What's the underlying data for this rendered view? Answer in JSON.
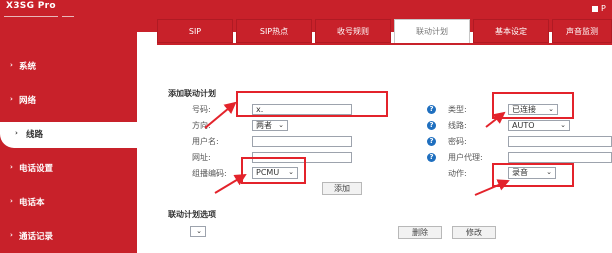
{
  "brand": {
    "model": "X3SG Pro"
  },
  "header_right": {
    "text": "P"
  },
  "sidebar": {
    "items": [
      {
        "label": "系统"
      },
      {
        "label": "网络"
      },
      {
        "label": "线路"
      },
      {
        "label": "电话设置"
      },
      {
        "label": "电话本"
      },
      {
        "label": "通话记录"
      }
    ],
    "active_index": 2
  },
  "tabs": [
    {
      "label": "SIP"
    },
    {
      "label": "SIP热点"
    },
    {
      "label": "收号规则"
    },
    {
      "label": "联动计划"
    },
    {
      "label": "基本设定"
    },
    {
      "label": "声音监测"
    }
  ],
  "active_tab": "联动计划",
  "form": {
    "title": "添加联动计划",
    "number_label": "号码:",
    "number_value": "x.",
    "direction_label": "方向:",
    "direction_value": "两者",
    "username_label": "用户名:",
    "url_label": "网址:",
    "codec_label": "组播编码:",
    "codec_value": "PCMU",
    "type_label": "类型:",
    "type_value": "已连接",
    "line_label": "线路:",
    "line_value": "AUTO",
    "password_label": "密码:",
    "proxy_label": "用户代理:",
    "action_label": "动作:",
    "action_value": "录音",
    "add_button": "添加"
  },
  "options": {
    "title": "联动计划选项",
    "delete_button": "删除",
    "modify_button": "修改"
  },
  "colors": {
    "brand_red": "#c8212a",
    "help_blue": "#1f6fbf",
    "annotation_red": "#e3232b"
  }
}
